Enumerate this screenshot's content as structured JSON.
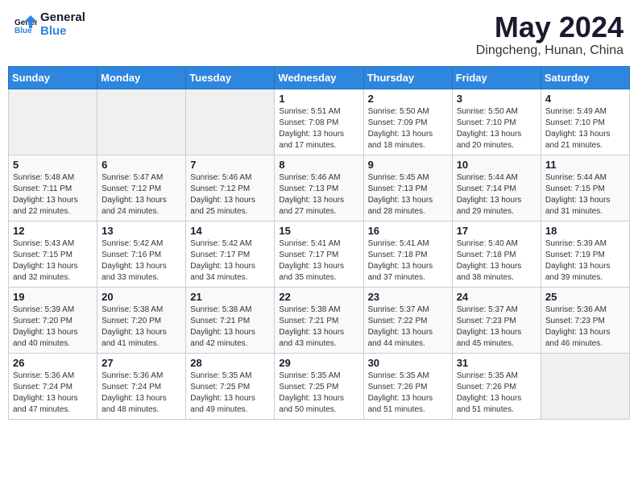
{
  "header": {
    "logo_line1": "General",
    "logo_line2": "Blue",
    "main_title": "May 2024",
    "subtitle": "Dingcheng, Hunan, China"
  },
  "weekdays": [
    "Sunday",
    "Monday",
    "Tuesday",
    "Wednesday",
    "Thursday",
    "Friday",
    "Saturday"
  ],
  "weeks": [
    [
      {
        "day": "",
        "detail": ""
      },
      {
        "day": "",
        "detail": ""
      },
      {
        "day": "",
        "detail": ""
      },
      {
        "day": "1",
        "detail": "Sunrise: 5:51 AM\nSunset: 7:08 PM\nDaylight: 13 hours and 17 minutes."
      },
      {
        "day": "2",
        "detail": "Sunrise: 5:50 AM\nSunset: 7:09 PM\nDaylight: 13 hours and 18 minutes."
      },
      {
        "day": "3",
        "detail": "Sunrise: 5:50 AM\nSunset: 7:10 PM\nDaylight: 13 hours and 20 minutes."
      },
      {
        "day": "4",
        "detail": "Sunrise: 5:49 AM\nSunset: 7:10 PM\nDaylight: 13 hours and 21 minutes."
      }
    ],
    [
      {
        "day": "5",
        "detail": "Sunrise: 5:48 AM\nSunset: 7:11 PM\nDaylight: 13 hours and 22 minutes."
      },
      {
        "day": "6",
        "detail": "Sunrise: 5:47 AM\nSunset: 7:12 PM\nDaylight: 13 hours and 24 minutes."
      },
      {
        "day": "7",
        "detail": "Sunrise: 5:46 AM\nSunset: 7:12 PM\nDaylight: 13 hours and 25 minutes."
      },
      {
        "day": "8",
        "detail": "Sunrise: 5:46 AM\nSunset: 7:13 PM\nDaylight: 13 hours and 27 minutes."
      },
      {
        "day": "9",
        "detail": "Sunrise: 5:45 AM\nSunset: 7:13 PM\nDaylight: 13 hours and 28 minutes."
      },
      {
        "day": "10",
        "detail": "Sunrise: 5:44 AM\nSunset: 7:14 PM\nDaylight: 13 hours and 29 minutes."
      },
      {
        "day": "11",
        "detail": "Sunrise: 5:44 AM\nSunset: 7:15 PM\nDaylight: 13 hours and 31 minutes."
      }
    ],
    [
      {
        "day": "12",
        "detail": "Sunrise: 5:43 AM\nSunset: 7:15 PM\nDaylight: 13 hours and 32 minutes."
      },
      {
        "day": "13",
        "detail": "Sunrise: 5:42 AM\nSunset: 7:16 PM\nDaylight: 13 hours and 33 minutes."
      },
      {
        "day": "14",
        "detail": "Sunrise: 5:42 AM\nSunset: 7:17 PM\nDaylight: 13 hours and 34 minutes."
      },
      {
        "day": "15",
        "detail": "Sunrise: 5:41 AM\nSunset: 7:17 PM\nDaylight: 13 hours and 35 minutes."
      },
      {
        "day": "16",
        "detail": "Sunrise: 5:41 AM\nSunset: 7:18 PM\nDaylight: 13 hours and 37 minutes."
      },
      {
        "day": "17",
        "detail": "Sunrise: 5:40 AM\nSunset: 7:18 PM\nDaylight: 13 hours and 38 minutes."
      },
      {
        "day": "18",
        "detail": "Sunrise: 5:39 AM\nSunset: 7:19 PM\nDaylight: 13 hours and 39 minutes."
      }
    ],
    [
      {
        "day": "19",
        "detail": "Sunrise: 5:39 AM\nSunset: 7:20 PM\nDaylight: 13 hours and 40 minutes."
      },
      {
        "day": "20",
        "detail": "Sunrise: 5:38 AM\nSunset: 7:20 PM\nDaylight: 13 hours and 41 minutes."
      },
      {
        "day": "21",
        "detail": "Sunrise: 5:38 AM\nSunset: 7:21 PM\nDaylight: 13 hours and 42 minutes."
      },
      {
        "day": "22",
        "detail": "Sunrise: 5:38 AM\nSunset: 7:21 PM\nDaylight: 13 hours and 43 minutes."
      },
      {
        "day": "23",
        "detail": "Sunrise: 5:37 AM\nSunset: 7:22 PM\nDaylight: 13 hours and 44 minutes."
      },
      {
        "day": "24",
        "detail": "Sunrise: 5:37 AM\nSunset: 7:23 PM\nDaylight: 13 hours and 45 minutes."
      },
      {
        "day": "25",
        "detail": "Sunrise: 5:36 AM\nSunset: 7:23 PM\nDaylight: 13 hours and 46 minutes."
      }
    ],
    [
      {
        "day": "26",
        "detail": "Sunrise: 5:36 AM\nSunset: 7:24 PM\nDaylight: 13 hours and 47 minutes."
      },
      {
        "day": "27",
        "detail": "Sunrise: 5:36 AM\nSunset: 7:24 PM\nDaylight: 13 hours and 48 minutes."
      },
      {
        "day": "28",
        "detail": "Sunrise: 5:35 AM\nSunset: 7:25 PM\nDaylight: 13 hours and 49 minutes."
      },
      {
        "day": "29",
        "detail": "Sunrise: 5:35 AM\nSunset: 7:25 PM\nDaylight: 13 hours and 50 minutes."
      },
      {
        "day": "30",
        "detail": "Sunrise: 5:35 AM\nSunset: 7:26 PM\nDaylight: 13 hours and 51 minutes."
      },
      {
        "day": "31",
        "detail": "Sunrise: 5:35 AM\nSunset: 7:26 PM\nDaylight: 13 hours and 51 minutes."
      },
      {
        "day": "",
        "detail": ""
      }
    ]
  ]
}
